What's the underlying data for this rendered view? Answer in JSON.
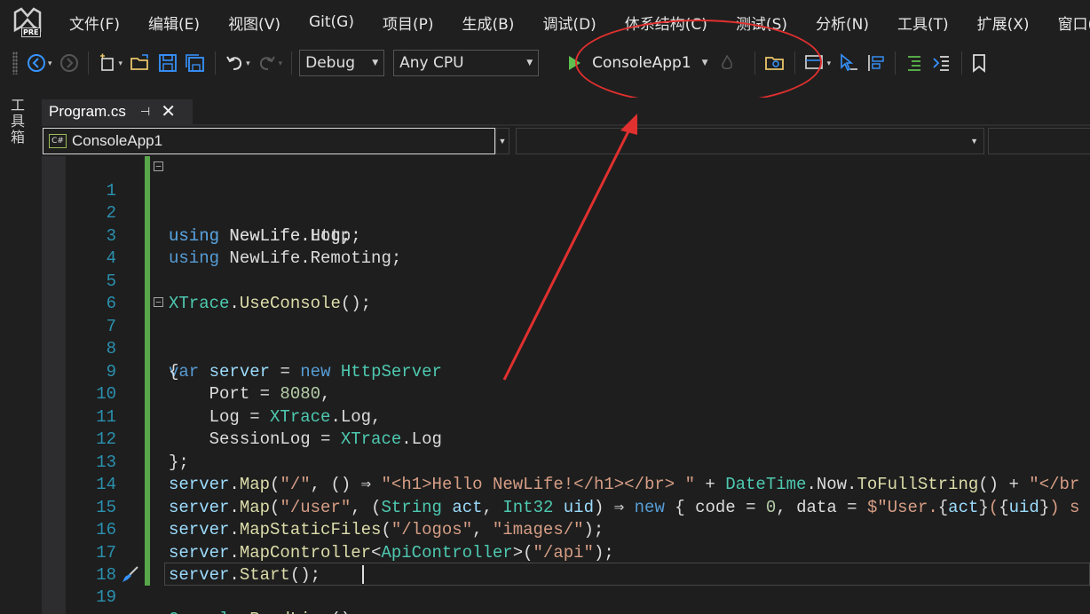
{
  "menu": {
    "items": [
      "文件(F)",
      "编辑(E)",
      "视图(V)",
      "Git(G)",
      "项目(P)",
      "生成(B)",
      "调试(D)",
      "体系结构(C)",
      "测试(S)",
      "分析(N)",
      "工具(T)",
      "扩展(X)",
      "窗口(W)"
    ],
    "badge": "PRE"
  },
  "toolbar": {
    "configuration": "Debug",
    "platform": "Any CPU",
    "run_target": "ConsoleApp1"
  },
  "toolbox": {
    "label": "工具箱"
  },
  "tab": {
    "title": "Program.cs",
    "pin": "⊣",
    "close": "✕"
  },
  "navbar": {
    "project": "ConsoleApp1",
    "cs_icon": "C#"
  },
  "editor": {
    "line_numbers": [
      "1",
      "2",
      "3",
      "4",
      "5",
      "6",
      "7",
      "8",
      "9",
      "10",
      "11",
      "12",
      "13",
      "14",
      "15",
      "16",
      "17",
      "18",
      "19"
    ]
  },
  "colors": {
    "annotation": "#e0302f",
    "change_bar": "#57a64a",
    "keyword": "#569cd6",
    "type": "#4ec9b0",
    "line_number": "#2b91af"
  }
}
